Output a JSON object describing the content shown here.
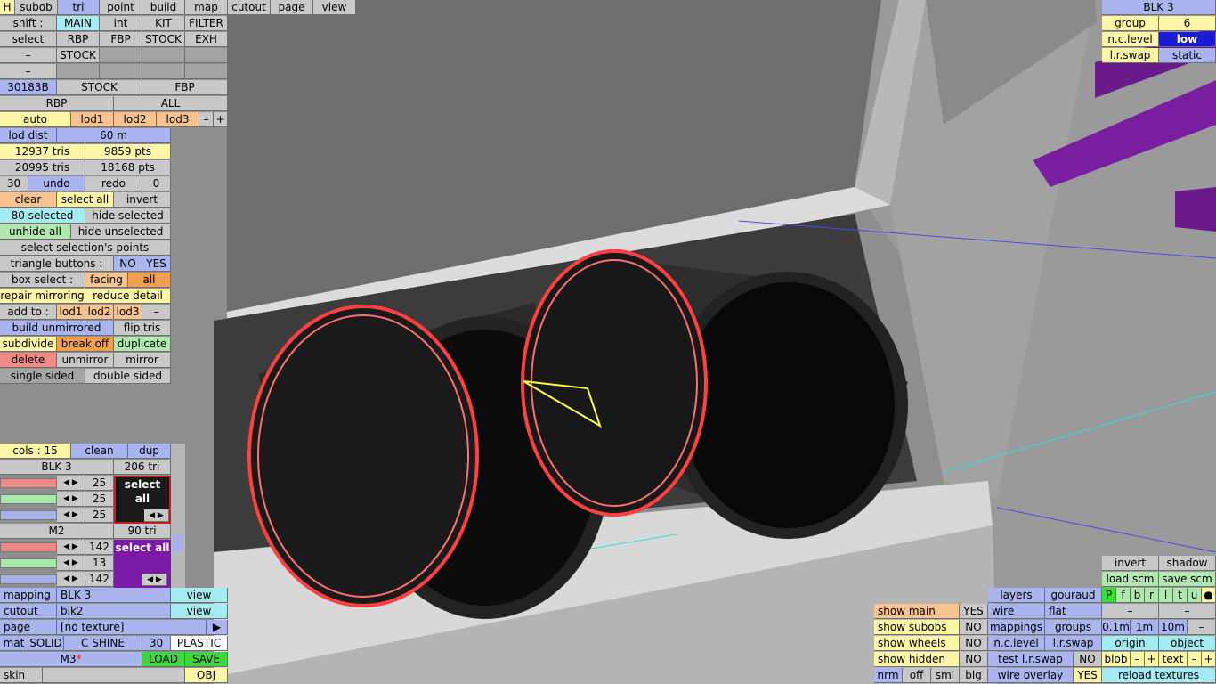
{
  "top_tabs": [
    "H",
    "subob",
    "tri",
    "point",
    "build",
    "map",
    "cutout",
    "page",
    "view"
  ],
  "row_shift": {
    "label": "shift :",
    "items": [
      "MAIN",
      "int",
      "KIT",
      "FILTER"
    ]
  },
  "row_select": {
    "label": "select",
    "items": [
      "RBP",
      "FBP",
      "STOCK",
      "EXH"
    ]
  },
  "row_dash1": {
    "label": "–",
    "items": [
      "STOCK"
    ]
  },
  "row_dash2": {
    "label": "–"
  },
  "row_parts": [
    "30183B",
    "STOCK",
    "FBP"
  ],
  "row_rbp": [
    "RBP",
    "ALL"
  ],
  "lod_row": [
    "auto",
    "lod1",
    "lod2",
    "lod3",
    "–",
    "+"
  ],
  "lod_dist": {
    "label": "lod dist",
    "value": "60 m"
  },
  "stats": [
    "12937 tris",
    "9859 pts",
    "20995 tris",
    "18168 pts"
  ],
  "undo_row": [
    "30",
    "undo",
    "redo",
    "0"
  ],
  "sel_row": [
    "clear",
    "select all",
    "invert"
  ],
  "selected_row": [
    "80 selected",
    "hide selected"
  ],
  "unhide_row": [
    "unhide all",
    "hide unselected"
  ],
  "select_points": "select selection's points",
  "triangle_buttons": {
    "label": "triangle buttons :",
    "no": "NO",
    "yes": "YES"
  },
  "box_select": {
    "label": "box select :",
    "facing": "facing",
    "all": "all"
  },
  "repair_row": [
    "repair mirroring",
    "reduce detail"
  ],
  "add_to": {
    "label": "add to :",
    "items": [
      "lod1",
      "lod2",
      "lod3",
      "–"
    ]
  },
  "build_row": [
    "build unmirrored",
    "flip tris"
  ],
  "subdivide_row": [
    "subdivide",
    "break off",
    "duplicate"
  ],
  "delete_row": [
    "delete",
    "unmirror",
    "mirror"
  ],
  "sided_row": [
    "single sided",
    "double sided"
  ],
  "cols_row": [
    "cols : 15",
    "clean",
    "dup"
  ],
  "mat1": {
    "name": "BLK 3",
    "tris": "206 tri",
    "values": [
      "25",
      "25",
      "25"
    ],
    "select": "select all",
    "color": "#1a1a1a"
  },
  "mat2": {
    "name": "M2",
    "tris": "90 tri",
    "values": [
      "142",
      "13",
      "142"
    ],
    "select": "select all",
    "color": "#7c1aa8"
  },
  "mapping": {
    "label": "mapping",
    "value": "BLK 3",
    "view": "view"
  },
  "cutout": {
    "label": "cutout",
    "value": "blk2",
    "view": "view"
  },
  "page": {
    "label": "page",
    "value": "[no texture]",
    "arrow": "▶"
  },
  "mat_row": [
    "mat",
    "SOLID",
    "C SHINE",
    "30",
    "PLASTIC"
  ],
  "m3_row": {
    "name": "M3",
    "mark": "*",
    "load": "LOAD",
    "save": "SAVE"
  },
  "skin_row": {
    "label": "skin",
    "obj": "OBJ"
  },
  "top_right": {
    "title": "BLK 3",
    "group_label": "group",
    "group_value": "6",
    "nc_label": "n.c.level",
    "nc_value": "low",
    "swap_label": "l.r.swap",
    "swap_value": "static"
  },
  "br_grid": {
    "row1": [
      "invert",
      "shadow"
    ],
    "row2": [
      "load scm",
      "save scm"
    ],
    "letters": [
      "P",
      "f",
      "b",
      "r",
      "l",
      "t",
      "u",
      "●"
    ],
    "row4": [
      "–",
      "–"
    ],
    "row5": [
      "0.1m",
      "1m",
      "10m",
      "–"
    ],
    "row6": [
      "origin",
      "object"
    ],
    "row7": [
      "blob",
      "–",
      "+",
      "text",
      "–",
      "+"
    ],
    "row8": "reload textures"
  },
  "br_mid": {
    "row1": [
      "layers",
      "gouraud"
    ],
    "row2": [
      "wire",
      "flat"
    ],
    "row3": [
      "mappings",
      "groups"
    ],
    "row4": [
      "n.c.level",
      "l.r.swap"
    ],
    "row5": [
      "test l.r.swap",
      "NO"
    ],
    "row6": [
      "wire overlay",
      "YES"
    ]
  },
  "br_left": {
    "row1": [
      "show main",
      "YES"
    ],
    "row2": [
      "show subobs",
      "NO"
    ],
    "row3": [
      "show wheels",
      "NO"
    ],
    "row4": [
      "show hidden",
      "NO"
    ],
    "row5": [
      "nrm",
      "off",
      "sml",
      "big"
    ]
  }
}
